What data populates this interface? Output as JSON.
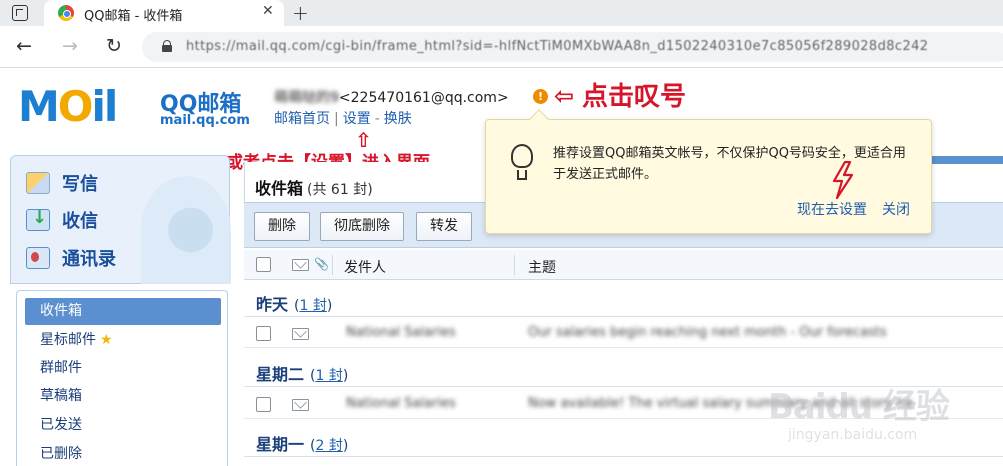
{
  "browser": {
    "tab_title": "QQ邮箱 - 收件箱",
    "tab_close": "✕",
    "new_tab": "+",
    "url": "https://mail.qq.com/cgi-bin/frame_html?sid=-hlfNctTiM0MXbWAA8n_d1502240310e7c85056f289028d8c242",
    "back": "←",
    "forward": "→",
    "reload": "↻"
  },
  "logo": {
    "brand_m": "M",
    "brand_o": "O",
    "brand_il": "il",
    "cn": "QQ邮箱",
    "en": "mail.qq.com"
  },
  "account": {
    "nickname": "萌萌哒的9",
    "email_masked": "<225470161@qq.com>",
    "warn_mark": "!"
  },
  "toplinks": {
    "home": "邮箱首页",
    "sep1": "|",
    "settings": "设置",
    "sep2": "-",
    "skin": "换肤"
  },
  "annotations": {
    "arrow_left": "⇦",
    "click_mark": "点击叹号",
    "arrow_up": "⇧",
    "or_settings": "或者点击【设置】进入界面"
  },
  "sidebar": {
    "write": "写信",
    "receive": "收信",
    "contacts": "通讯录",
    "folders": [
      {
        "label": "收件箱"
      },
      {
        "label": "星标邮件"
      },
      {
        "label": "群邮件"
      },
      {
        "label": "草稿箱"
      },
      {
        "label": "已发送"
      },
      {
        "label": "已删除"
      }
    ],
    "star_glyph": "★"
  },
  "main": {
    "title": "收件箱",
    "count": "(共 61 封)",
    "buttons": [
      "删除",
      "彻底删除",
      "转发"
    ],
    "columns": {
      "sender": "发件人",
      "subject": "主题"
    },
    "clip": "📎",
    "groups": [
      {
        "label": "昨天",
        "count_open": "(",
        "count_link": "1 封",
        "count_close": ")"
      },
      {
        "label": "星期二",
        "count_open": "(",
        "count_link": "1 封",
        "count_close": ")"
      },
      {
        "label": "星期一",
        "count_open": "(",
        "count_link": "2 封",
        "count_close": ")"
      }
    ],
    "rows": [
      {
        "sender": "National Salaries",
        "subject": "Our salaries begin reaching next month - Our forecasts"
      },
      {
        "sender": "National Salaries",
        "subject": "Now available! The virtual salary summary and all story ha"
      }
    ]
  },
  "popup": {
    "message": "推荐设置QQ邮箱英文帐号，不仅保护QQ号码安全，更适合用于发送正式邮件。",
    "go_setup": "现在去设置",
    "close": "关闭"
  },
  "watermark": {
    "big": "Baidu 经验",
    "small": "jingyan.baidu.com"
  },
  "colors": {
    "accent_blue": "#1c6fc4",
    "annotation_red": "#d6142a",
    "selected_folder": "#5b8fcf",
    "popup_bg": "#fffae0"
  }
}
